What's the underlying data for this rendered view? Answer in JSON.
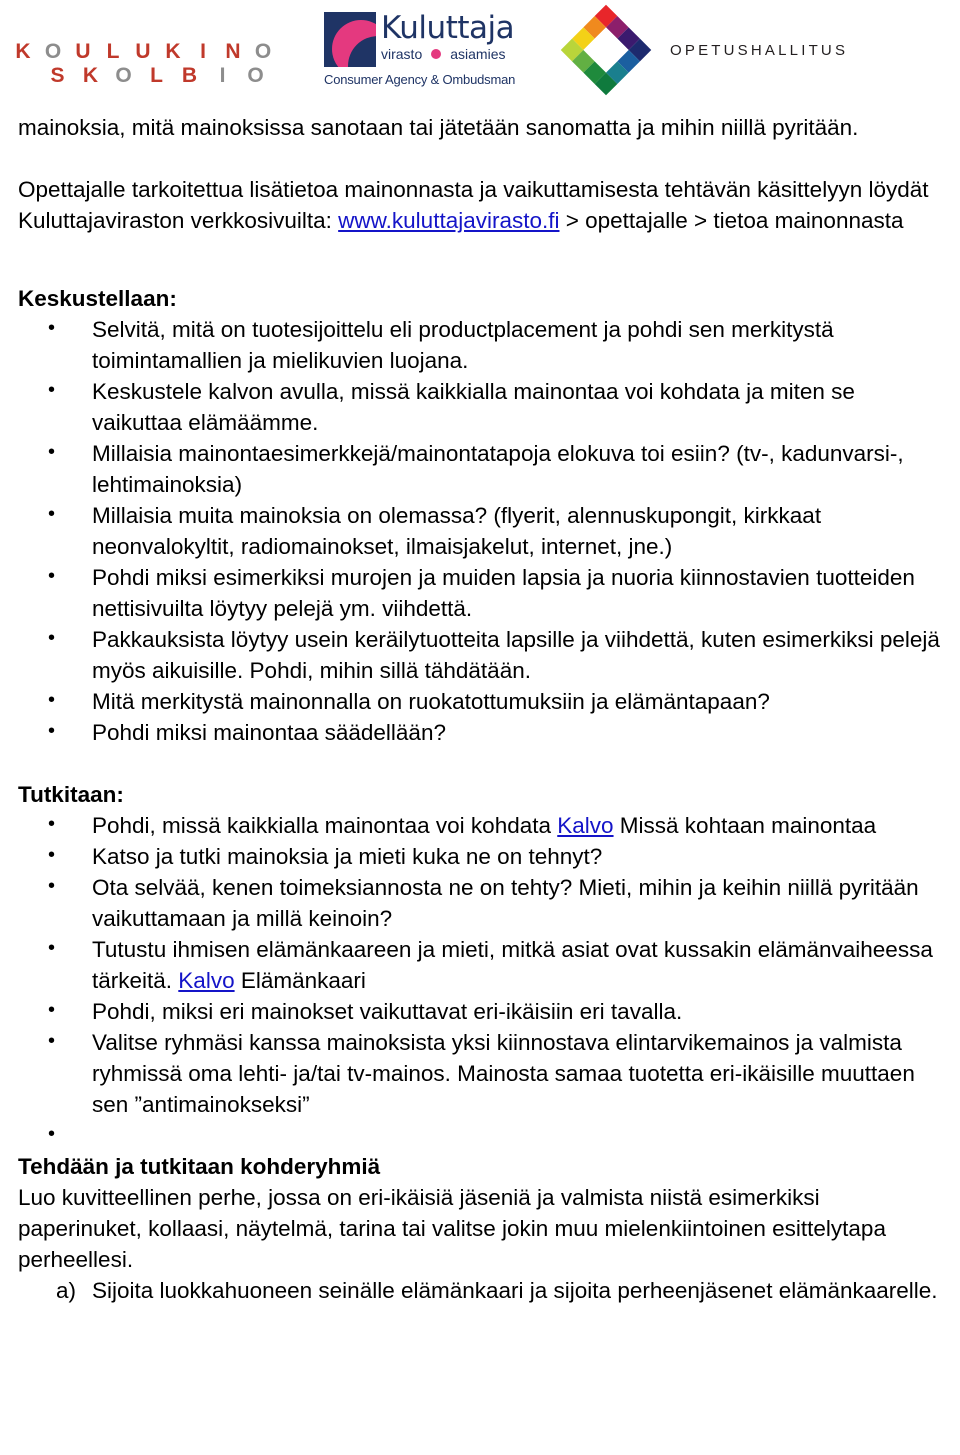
{
  "header": {
    "logos": [
      {
        "name": "koulukino-skolbio-logo",
        "row1": [
          "K",
          "O",
          "U",
          "L",
          "U",
          "K",
          "I",
          "N",
          "O"
        ],
        "row2": [
          "",
          "S",
          "K",
          "O",
          "L",
          "B",
          "I",
          "O"
        ],
        "colors": {
          "red": "#c0392b",
          "gray": "#8d8d8d"
        }
      },
      {
        "name": "kuluttaja-logo",
        "title": "Kuluttaja",
        "sub_left": "virasto",
        "sub_right": "asiamies",
        "english": "Consumer Agency & Ombudsman",
        "colors": {
          "navy": "#1f3465",
          "pink": "#e4397f"
        }
      },
      {
        "name": "opetushallitus-logo",
        "text": "OPETUSHALLITUS",
        "diamond_colors": [
          "#e8262a",
          "#8c1f6b",
          "#3b1a6e",
          "#1d2a6e",
          "#f08a1e",
          "#ffffff",
          "#ffffff",
          "#1b5fa0",
          "#f3d117",
          "#ffffff",
          "#ffffff",
          "#1a7f8e",
          "#b9d53a",
          "#62b043",
          "#1f8a3c",
          "#0f7a3d"
        ]
      }
    ]
  },
  "body": {
    "intro_paragraph": "mainoksia, mitä mainoksissa sanotaan tai jätetään sanomatta ja mihin niillä pyritään.",
    "teacher_info_pre": "Opettajalle tarkoitettua lisätietoa mainonnasta ja vaikuttamisesta tehtävän käsittelyyn löydät Kuluttajaviraston verkkosivuilta: ",
    "teacher_info_link": "www.kuluttajavirasto.fi",
    "teacher_info_post": " > opettajalle > tietoa mainonnasta",
    "keskustellaan": {
      "heading": "Keskustellaan:",
      "items": [
        "Selvitä, mitä on tuotesijoittelu eli productplacement ja pohdi sen merkitystä toimintamallien ja mielikuvien luojana.",
        "Keskustele kalvon avulla, missä kaikkialla mainontaa voi kohdata ja miten se vaikuttaa elämäämme.",
        "Millaisia mainontaesimerkkejä/mainontatapoja elokuva toi esiin? (tv-, kadunvarsi-, lehtimainoksia)",
        "Millaisia muita mainoksia on olemassa? (flyerit, alennuskupongit, kirkkaat neonvalokyltit, radiomainokset, ilmaisjakelut, internet, jne.)",
        "Pohdi miksi esimerkiksi murojen ja muiden lapsia ja nuoria kiinnostavien tuotteiden nettisivuilta löytyy pelejä ym. viihdettä.",
        "Pakkauksista löytyy usein keräilytuotteita lapsille ja viihdettä, kuten esimerkiksi pelejä myös aikuisille. Pohdi, mihin sillä tähdätään.",
        "Mitä merkitystä mainonnalla on ruokatottumuksiin ja elämäntapaan?",
        "Pohdi miksi mainontaa säädellään?"
      ]
    },
    "tutkitaan": {
      "heading": "Tutkitaan:",
      "item1_pre": "Pohdi, missä kaikkialla mainontaa voi kohdata ",
      "item1_link": "Kalvo",
      "item1_post": " Missä kohtaan mainontaa",
      "item2": "Katso ja tutki mainoksia ja mieti kuka ne on tehnyt?",
      "item3": "Ota selvää, kenen toimeksiannosta ne on tehty? Mieti, mihin ja keihin niillä pyritään vaikuttamaan ja millä keinoin?",
      "item4_pre": "Tutustu ihmisen elämänkaareen ja mieti, mitkä asiat ovat kussakin elämänvaiheessa tärkeitä. ",
      "item4_link": "Kalvo",
      "item4_post": " Elämänkaari",
      "item5": "Pohdi, miksi eri mainokset vaikuttavat eri-ikäisiin eri tavalla.",
      "item6": "Valitse ryhmäsi kanssa mainoksista yksi kiinnostava elintarvikemainos ja valmista ryhmissä oma lehti- ja/tai tv-mainos. Mainosta samaa tuotetta eri-ikäisille muuttaen sen ”antimainokseksi”",
      "item7": ""
    },
    "kohderyhmia": {
      "heading": "Tehdään ja tutkitaan kohderyhmiä",
      "paragraph": "Luo kuvitteellinen perhe, jossa on eri-ikäisiä jäseniä ja valmista niistä esimerkiksi paperinuket, kollaasi, näytelmä, tarina tai valitse jokin muu mielenkiintoinen esittelytapa perheellesi.",
      "sub_items": [
        {
          "marker": "a)",
          "text": "Sijoita luokkahuoneen seinälle elämänkaari ja sijoita perheenjäsenet elämänkaarelle."
        }
      ]
    }
  }
}
